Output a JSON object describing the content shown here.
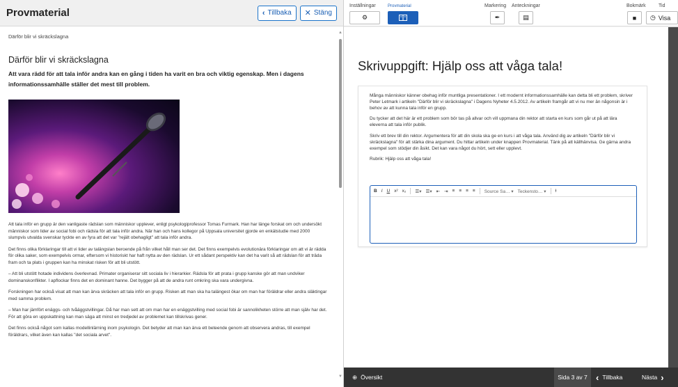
{
  "left": {
    "title": "Provmaterial",
    "back_label": "Tillbaka",
    "close_label": "Stäng",
    "breadcrumb": "Därför blir vi skräckslagna",
    "article_title": "Därför blir vi skräckslagna",
    "lead": "Att vara rädd för att tala inför andra kan en gång i tiden ha varit en bra och viktig egenskap. Men i dagens informationssamhälle ställer det mest till problem.",
    "paragraphs": [
      "Att tala inför en grupp är den vanligaste rädslan som människor upplever, enligt psykologiprofessor Tomas Furmark. Han har länge forskat om och undersökt människor som lider av social fobi och rädsla för att tala inför andra. När han och hans kollegor på Uppsala universitet gjorde en enkätstudie med 2000 slumpvis utvalda svenskar tyckte en av fyra att det var \"rejält obehagligt\" att tala inför andra.",
      "Det finns olika förklaringar till att vi lider av talängslan beroende på från vilket håll man ser det. Det finns exempelvis evolutionära förklaringar om att vi är rädda för olika saker, som exempelvis ormar, eftersom vi historiskt har haft nytta av den rädslan. Ur ett sådant perspektiv kan det ha varit så att rädslan för att träda fram och ta plats i gruppen kan ha minskat risken för att bli utstött.",
      "– Att bli utstött hotade individens överlevnad. Primater organiserar sitt sociala liv i hierarkier. Rädsla för att prata i grupp kanske gör att man undviker dominanskonflikter. I apflockar finns det en dominant hanne. Det bygger på att de andra runt omkring ska vara undergivna.",
      "Forskningen har också visat att man kan ärva skräcken att tala inför en grupp. Risken att man ska ha talängest ökar om man har föräldrar eller andra släktingar med samma problem.",
      "– Man har jämfört enäggs- och tvåäggstvillingar. Då har man sett att om man har en enäggstvilling med social fobi är sannolikheten större att man själv har det. För att göra en uppskattning kan man säga att minst en tredjedel av problemet kan tillskrivas gener.",
      "Det finns också något som kallas modellinlärning inom psykologin. Det betyder att man kan ärva ett beteende genom att observera andras, till exempel föräldrars, vilket även kan kallas \"det sociala arvet\"."
    ]
  },
  "toolbar": {
    "settings_label": "Inställningar",
    "material_label": "Provmaterial",
    "marking_label": "Markering",
    "notes_label": "Anteckningar",
    "bookmark_label": "Bokmärk",
    "time_label": "Tid",
    "show_label": "Visa"
  },
  "task": {
    "title": "Skrivuppgift: Hjälp oss att våga tala!",
    "paragraphs": [
      "Många människor känner obehag inför muntliga presentationer. I ett modernt informationssamhälle kan detta bli ett problem, skriver Peter Letmark i artikeln \"Därför blir vi skräckslagna\" i Dagens Nyheter 4.5.2012. Av artikeln framgår att vi nu mer än någonsin är i behov av att kunna tala inför en grupp.",
      "Du tycker att det här är ett problem som bör tas på allvar och vill uppmana din rektor att starta en kurs som går ut på att lära eleverna att tala inför publik.",
      "Skriv ett brev till din rektor. Argumentera för att din skola ska ge en kurs i att våga tala. Använd dig av artikeln \"Därför blir vi skräckslagna\" för att stärka dina argument. Du hittar artikeln under knappen Provmaterial. Tänk på att källhänvisa. Ge gärna andra exempel som stödjer din åsikt. Det kan vara något du hört, sett eller upplevt.",
      "Rubrik: Hjälp oss att våga tala!"
    ]
  },
  "editor": {
    "bold": "B",
    "italic": "I",
    "underline": "U",
    "superscript": "x²",
    "subscript": "x₂",
    "font_family": "Source Sa…",
    "char_style": "Teckensto…"
  },
  "footer": {
    "overview_label": "Översikt",
    "page_indicator": "Sida 3 av 7",
    "back_label": "Tillbaka",
    "next_label": "Nästa"
  }
}
